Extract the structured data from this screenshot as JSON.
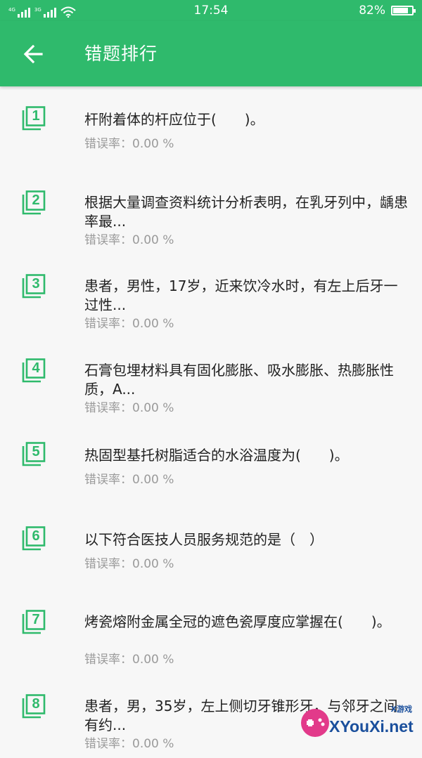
{
  "status_bar": {
    "sim1_label": "4G",
    "sim2_label": "3G",
    "time": "17:54",
    "battery_percent_text": "82%",
    "battery_level": 0.82
  },
  "app_bar": {
    "title": "错题排行"
  },
  "colors": {
    "accent": "#2fba6c",
    "error_text": "#9a9a9a"
  },
  "items": [
    {
      "rank": "1",
      "question": "杆附着体的杆应位于(　　)。",
      "error_rate": "错误率：0.00 %"
    },
    {
      "rank": "2",
      "question": "根据大量调查资料统计分析表明，在乳牙列中，龋患率最...",
      "error_rate": "错误率：0.00 %"
    },
    {
      "rank": "3",
      "question": "患者，男性，17岁，近来饮冷水时，有左上后牙一过性...",
      "error_rate": "错误率：0.00 %"
    },
    {
      "rank": "4",
      "question": "石膏包埋材料具有固化膨胀、吸水膨胀、热膨胀性质，A...",
      "error_rate": "错误率：0.00 %"
    },
    {
      "rank": "5",
      "question": "热固型基托树脂适合的水浴温度为(　　)。",
      "error_rate": "错误率：0.00 %"
    },
    {
      "rank": "6",
      "question": "以下符合医技人员服务规范的是（　）",
      "error_rate": "错误率：0.00 %"
    },
    {
      "rank": "7",
      "question": "烤瓷熔附金属全冠的遮色瓷厚度应掌握在(　　)。",
      "error_rate": "错误率：0.00 %"
    },
    {
      "rank": "8",
      "question": "患者，男，35岁，左上侧切牙锥形牙，与邻牙之间有约...",
      "error_rate": "错误率：0.00 %"
    }
  ],
  "watermark": {
    "site": "XYouXi.net",
    "label": "X游戏"
  }
}
